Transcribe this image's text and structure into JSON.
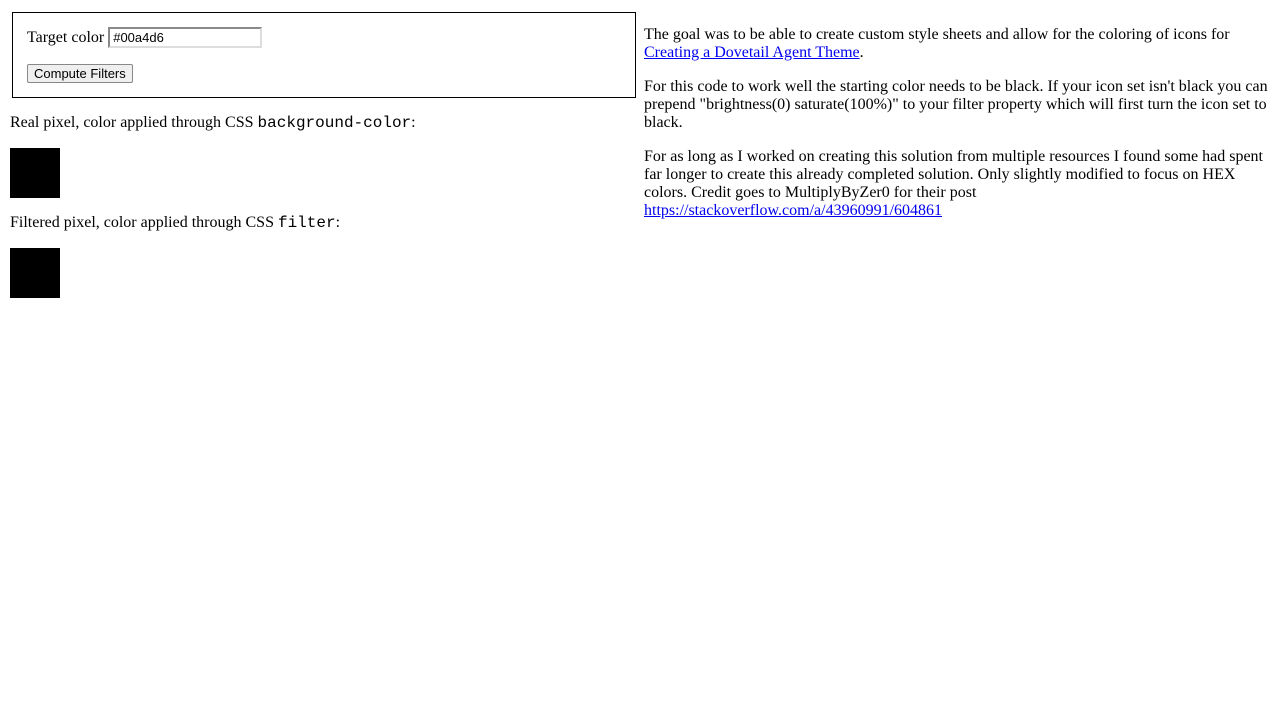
{
  "form": {
    "target_color_label": "Target color",
    "target_color_value": "#00a4d6",
    "compute_button": "Compute Filters"
  },
  "left": {
    "real_label_pre": "Real pixel, color applied through CSS ",
    "real_label_code": "background-color",
    "real_label_post": ":",
    "filtered_label_pre": "Filtered pixel, color applied through CSS ",
    "filtered_label_code": "filter",
    "filtered_label_post": ":",
    "swatch_color": "#000000"
  },
  "right": {
    "p1_pre": "The goal was to be able to create custom style sheets and allow for the coloring of icons for ",
    "p1_link": "Creating a Dovetail Agent Theme",
    "p1_post": ".",
    "p2": "For this code to work well the starting color needs to be black. If your icon set isn't black you can prepend \"brightness(0) saturate(100%)\" to your filter property which will first turn the icon set to black.",
    "p3_pre": "For as long as I worked on creating this solution from multiple resources I found some had spent far longer to create this already completed solution. Only slightly modified to focus on HEX colors. Credit goes to MultiplyByZer0 for their post ",
    "p3_link": "https://stackoverflow.com/a/43960991/604861"
  }
}
